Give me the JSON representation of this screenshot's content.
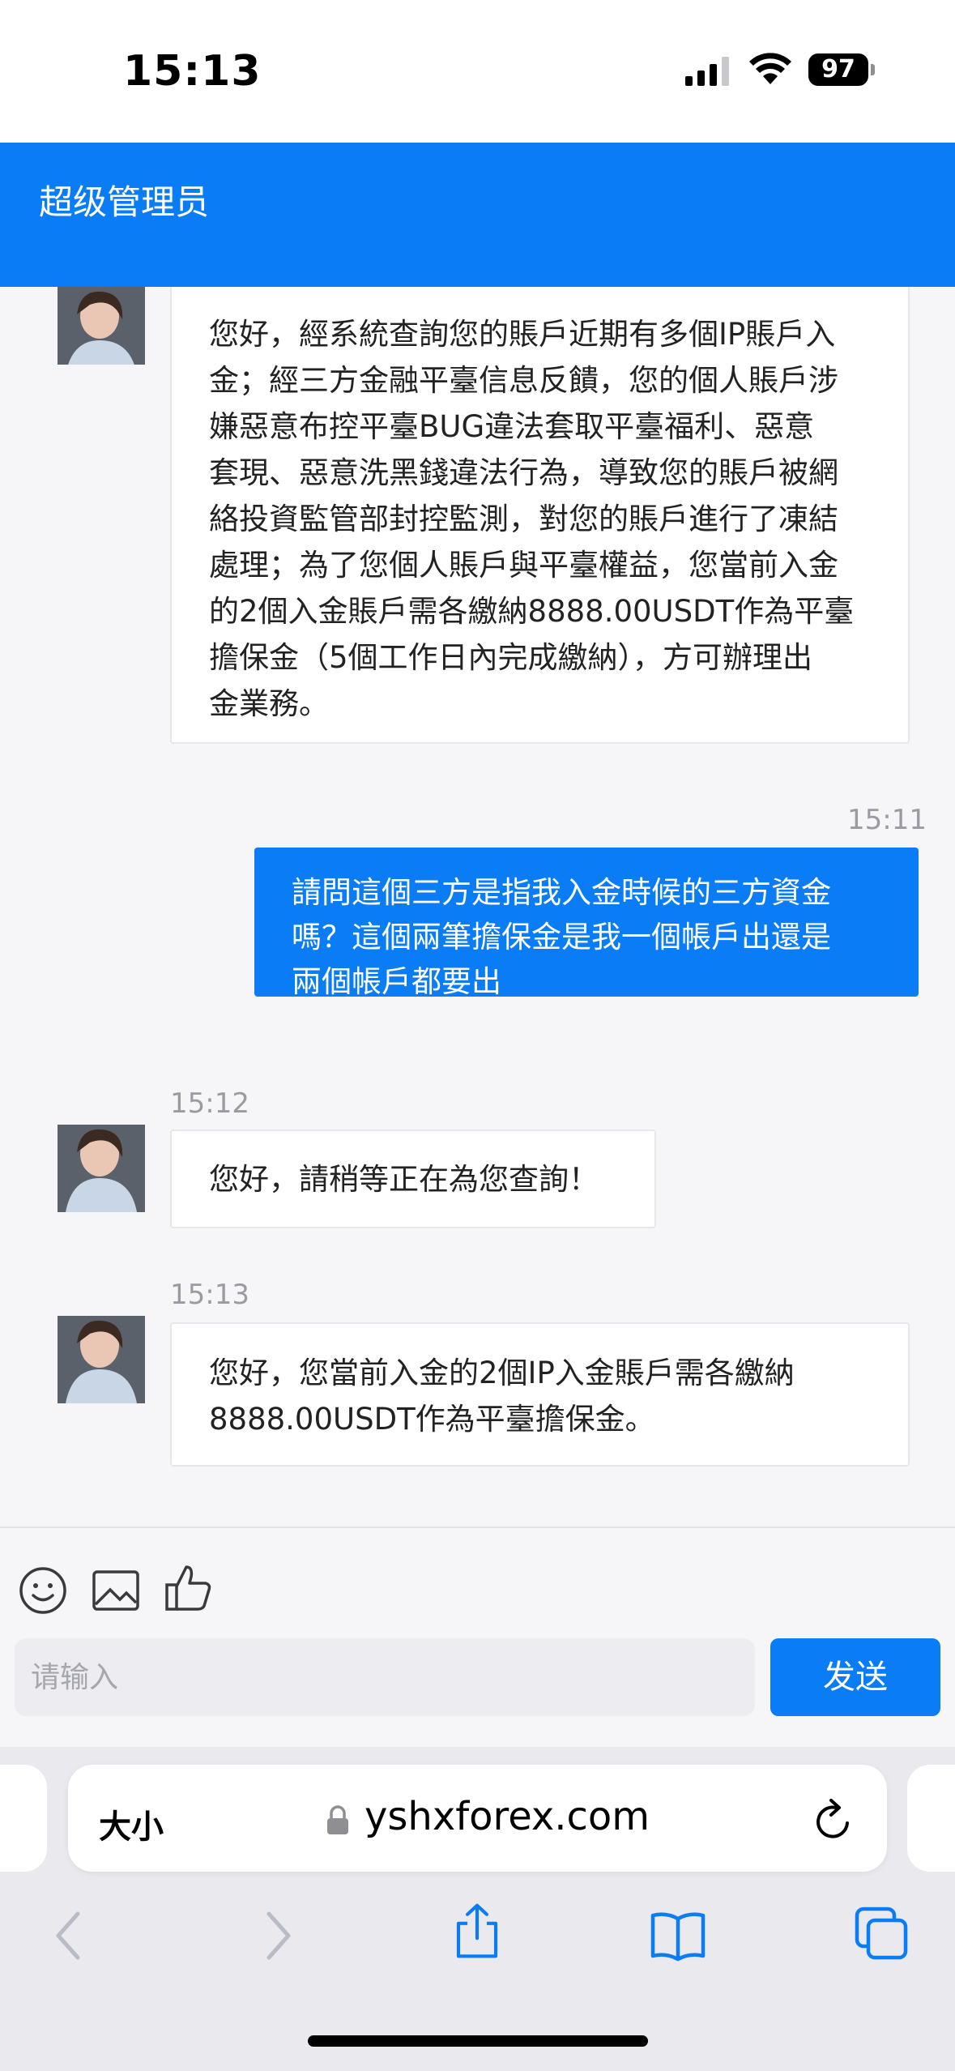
{
  "status_bar": {
    "time": "15:13",
    "battery": "97"
  },
  "header": {
    "title": "超级管理员"
  },
  "messages": [
    {
      "side": "in",
      "time": "",
      "lines": [
        "您好，經系統查詢您的賬戶近期有多個IP賬戶入",
        "金；經三方金融平臺信息反饋，您的個人賬戶涉",
        "嫌惡意布控平臺BUG違法套取平臺福利、惡意",
        "套現、惡意洗黑錢違法行為，導致您的賬戶被網",
        "絡投資監管部封控監測，對您的賬戶進行了凍結",
        "處理；為了您個人賬戶與平臺權益，您當前入金",
        "的2個入金賬戶需各繳納8888.00USDT作為平臺",
        "擔保金（5個工作日內完成繳納），方可辦理出",
        "金業務。"
      ]
    },
    {
      "side": "out",
      "time": "15:11",
      "lines": [
        "請問這個三方是指我入金時候的三方資金",
        "嗎？這個兩筆擔保金是我一個帳戶出還是",
        "兩個帳戶都要出"
      ]
    },
    {
      "side": "in",
      "time": "15:12",
      "lines": [
        "您好，請稍等正在為您查詢！"
      ]
    },
    {
      "side": "in",
      "time": "15:13",
      "lines": [
        "您好，您當前入金的2個IP入金賬戶需各繳納",
        "8888.00USDT作為平臺擔保金。"
      ]
    }
  ],
  "composer": {
    "tools": [
      "emoji-icon",
      "image-icon",
      "thumbs-up-icon"
    ],
    "placeholder": "请输入",
    "send_label": "发送"
  },
  "browser": {
    "aa_label": "大小",
    "url": "yshxforex.com",
    "nav_icons": [
      "back-icon",
      "forward-icon",
      "share-icon",
      "bookmarks-icon",
      "tabs-icon"
    ]
  },
  "colors": {
    "accent": "#0a7cf6",
    "chat_bg": "#f6f6f8",
    "bubble_in": "#ffffff"
  }
}
